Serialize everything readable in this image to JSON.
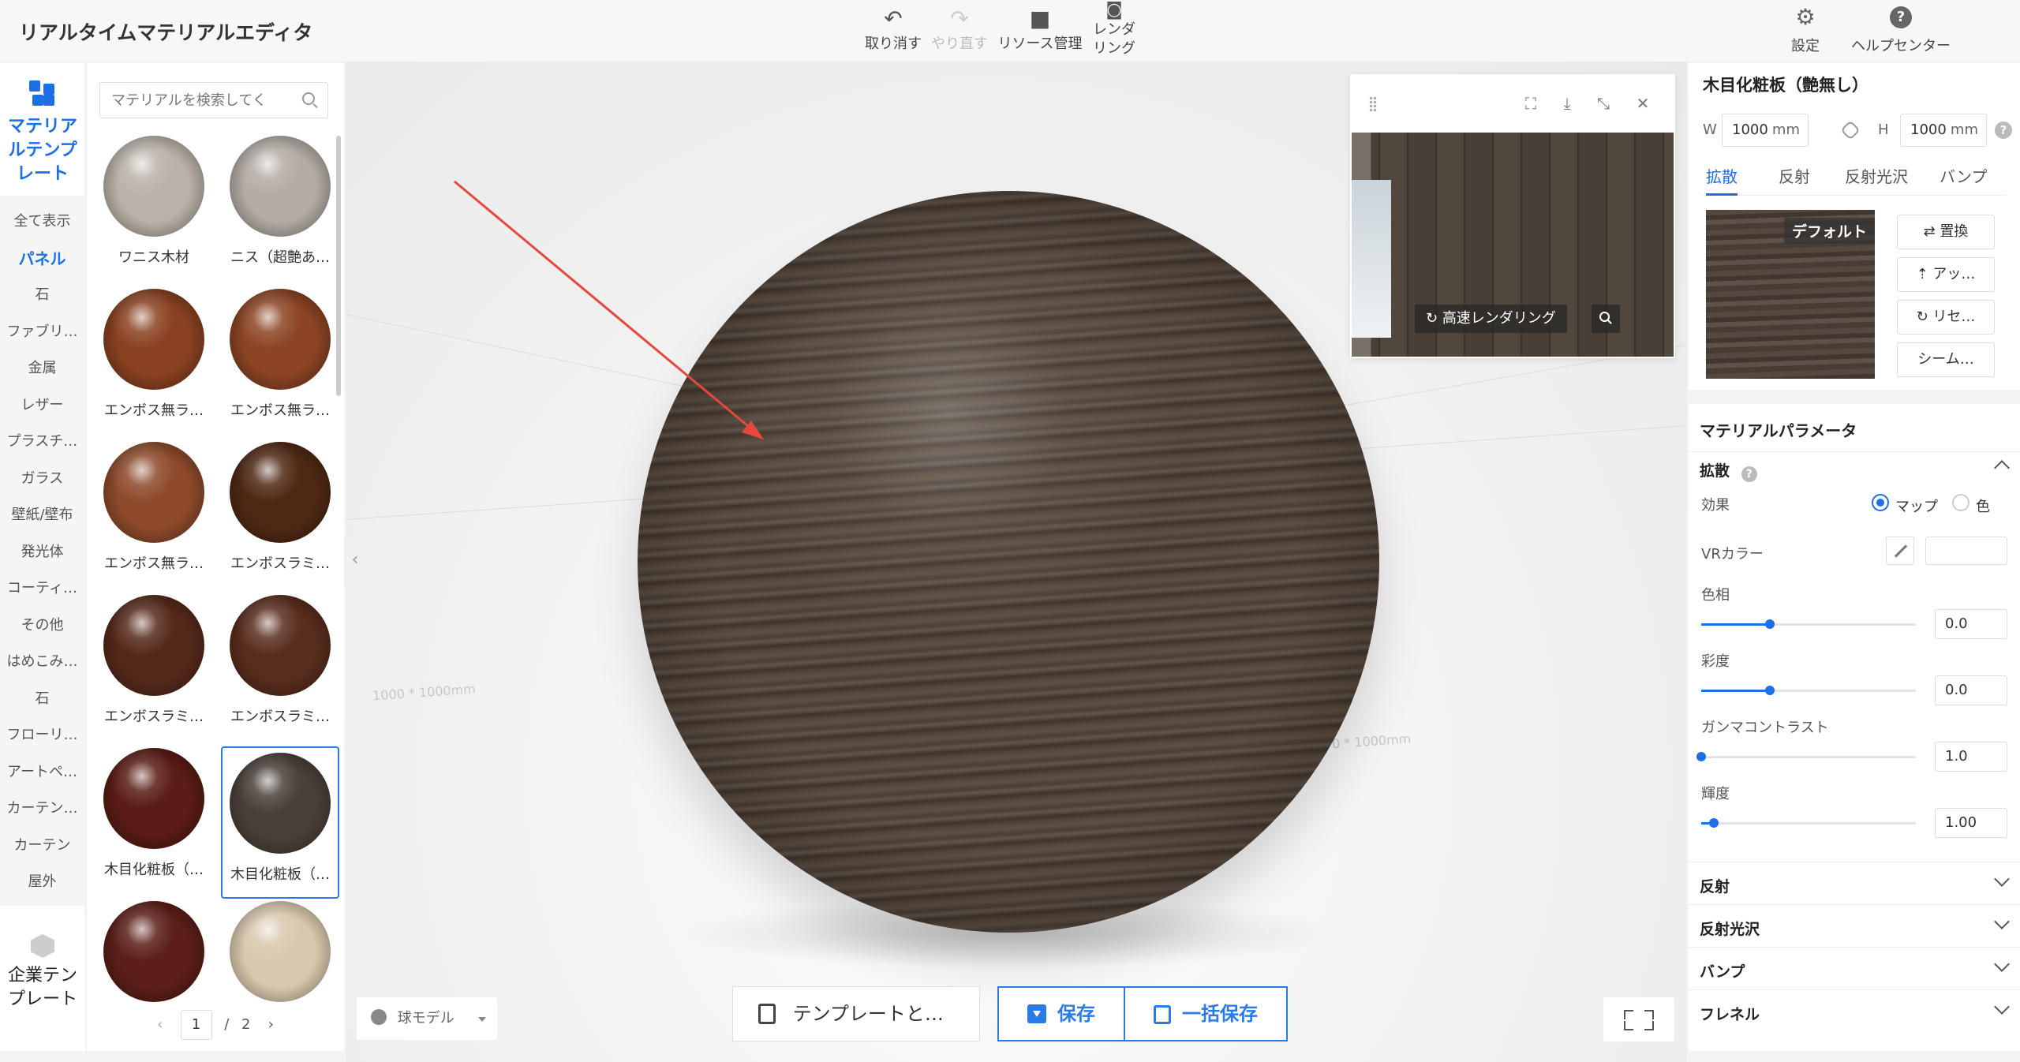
{
  "app": {
    "title": "リアルタイムマテリアルエディタ"
  },
  "toolbar": {
    "undo": "取り消す",
    "redo": "やり直す",
    "resources": "リソース管理",
    "render": "レンダ\nリング",
    "settings": "設定",
    "help": "ヘルプセンター"
  },
  "rail": {
    "head": "マテリアルテンプレート",
    "categories": [
      "全て表示",
      "パネル",
      "石",
      "ファブリ…",
      "金属",
      "レザー",
      "プラスチ…",
      "ガラス",
      "壁紙/壁布",
      "発光体",
      "コーティ…",
      "その他",
      "はめこみ…",
      "石",
      "フローリ…",
      "アートペ…",
      "カーテン…",
      "カーテン",
      "屋外"
    ],
    "active_index": 1,
    "foot": "企業テンプレート"
  },
  "materials": {
    "search_placeholder": "マテリアルを検索してく",
    "items": [
      {
        "label": "ワニス木材",
        "color": "#b9b2a8"
      },
      {
        "label": "ニス（超艶あ…",
        "color": "#b3aca4"
      },
      {
        "label": "エンボス無ラ…",
        "color": "#8a4121"
      },
      {
        "label": "エンボス無ラ…",
        "color": "#8c4424"
      },
      {
        "label": "エンボス無ラ…",
        "color": "#8e4a2b"
      },
      {
        "label": "エンボスラミ…",
        "color": "#4f2814"
      },
      {
        "label": "エンボスラミ…",
        "color": "#55291a"
      },
      {
        "label": "エンボスラミ…",
        "color": "#592d1d"
      },
      {
        "label": "木目化粧板（…",
        "color": "#5a1c14"
      },
      {
        "label": "木目化粧板（…",
        "color": "#4a4038"
      },
      {
        "label": "",
        "color": "#5c1e18"
      },
      {
        "label": "",
        "color": "#d9c8ad"
      }
    ],
    "selected_index": 9,
    "page": "1",
    "total": "2"
  },
  "viewport": {
    "floor_label_1": "1000 * 1000mm",
    "floor_label_2": "0 * 1000mm",
    "model_select": "球モデル",
    "template_button": "テンプレートと…",
    "save_button": "保存",
    "batch_save_button": "一括保存"
  },
  "preview": {
    "render_button": "高速レンダリング"
  },
  "properties": {
    "title": "木目化粧板（艶無し）",
    "width_label": "W",
    "width_value": "1000",
    "height_label": "H",
    "height_value": "1000",
    "unit": "mm",
    "tabs": [
      "拡散",
      "反射",
      "反射光沢",
      "バンプ"
    ],
    "texture_tag": "デフォルト",
    "replace_button": "置換",
    "upload_button": "アッ…",
    "reset_button": "リセ…",
    "seamless_button": "シーム…"
  },
  "params": {
    "title": "マテリアルパラメータ",
    "diffuse_section": "拡散",
    "effect_label": "効果",
    "radio_map": "マップ",
    "radio_color": "色",
    "vr_color_label": "VRカラー",
    "sliders": [
      {
        "label": "色相",
        "value": "0.0",
        "level": 0.32
      },
      {
        "label": "彩度",
        "value": "0.0",
        "level": 0.32
      },
      {
        "label": "ガンマコントラスト",
        "value": "1.0",
        "level": 0.0
      },
      {
        "label": "輝度",
        "value": "1.00",
        "level": 0.06
      }
    ],
    "collapsed_sections": [
      "反射",
      "反射光沢",
      "バンプ",
      "フレネル"
    ]
  }
}
